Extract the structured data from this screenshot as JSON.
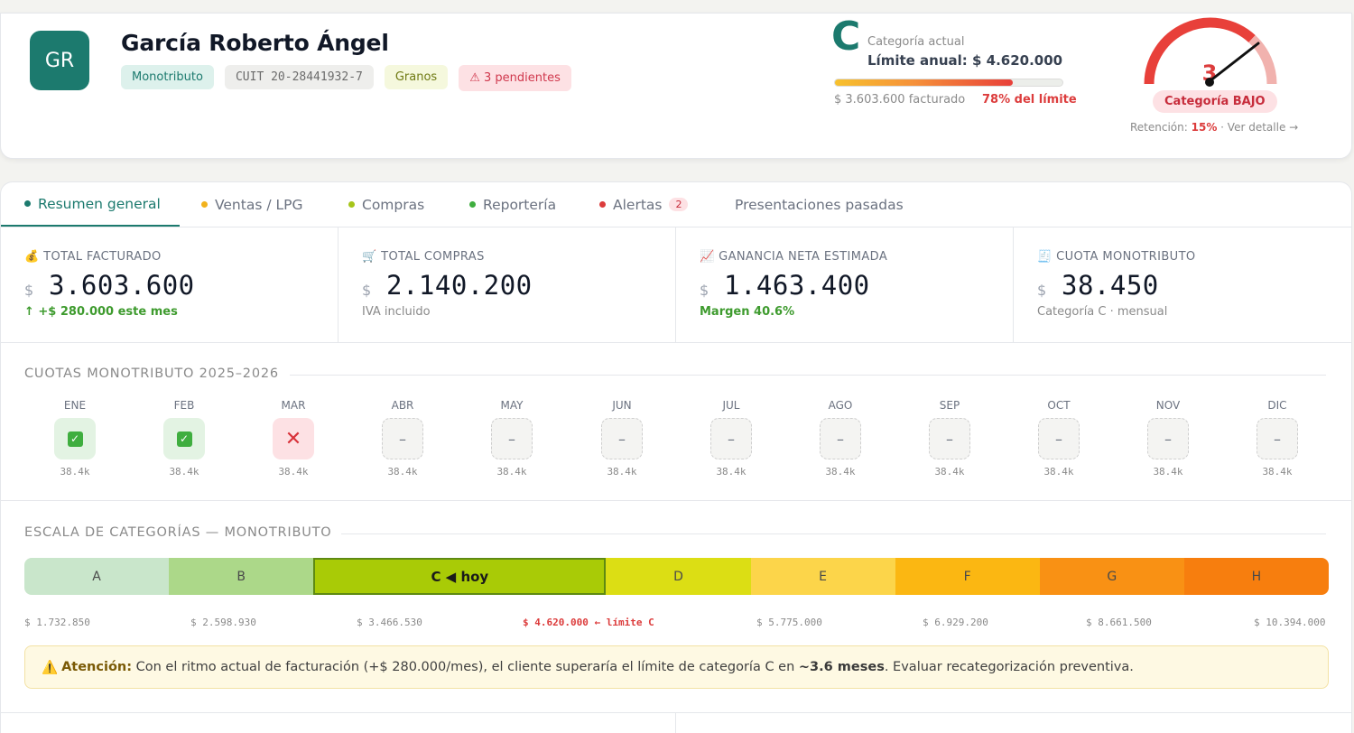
{
  "client": {
    "initials": "GR",
    "name": "García Roberto Ángel",
    "badges": {
      "regime": "Monotributo",
      "cuit": "CUIT 20-28441932-7",
      "activity": "Granos",
      "pending": "⚠ 3 pendientes"
    }
  },
  "category": {
    "letter": "C",
    "label": "Categoría actual",
    "limit_text": "Límite anual: $ 4.620.000",
    "billed_text": "$ 3.603.600 facturado",
    "pct_text": "78% del límite",
    "pct_value": 0.78
  },
  "risk": {
    "gauge_value": "3",
    "badge": "Categoría BAJO",
    "retention_prefix": "Retención: ",
    "retention_value": "15%",
    "retention_suffix": " · Ver detalle →",
    "colors": {
      "high": "#e8403a",
      "low": "#f1b2ae",
      "needle": "#111111"
    }
  },
  "tabs": [
    {
      "label": "Resumen general",
      "dot": "#1c7a6e",
      "active": true
    },
    {
      "label": "Ventas / LPG",
      "dot": "#f2b21c"
    },
    {
      "label": "Compras",
      "dot": "#a6c51a"
    },
    {
      "label": "Reportería",
      "dot": "#3fae3f"
    },
    {
      "label": "Alertas",
      "dot": "#dc3c3c",
      "count": "2"
    },
    {
      "label": "Presentaciones pasadas"
    }
  ],
  "stats": [
    {
      "icon": "money-bag-icon",
      "glyph": "💰",
      "label": "TOTAL FACTURADO",
      "currency": "$",
      "value": "3.603.600",
      "note": "↑ +$ 280.000 este mes",
      "note_green": true
    },
    {
      "icon": "cart-icon",
      "glyph": "🛒",
      "label": "TOTAL COMPRAS",
      "currency": "$",
      "value": "2.140.200",
      "note": "IVA incluido"
    },
    {
      "icon": "chart-up-icon",
      "glyph": "📈",
      "label": "GANANCIA NETA ESTIMADA",
      "currency": "$",
      "value": "1.463.400",
      "note": "Margen 40.6%",
      "note_green": true
    },
    {
      "icon": "receipt-icon",
      "glyph": "🧾",
      "label": "CUOTA MONOTRIBUTO",
      "currency": "$",
      "value": "38.450",
      "note": "Categoría C · mensual"
    }
  ],
  "quotas": {
    "title": "CUOTAS MONOTRIBUTO 2025–2026",
    "months": [
      {
        "name": "ENE",
        "status": "paid",
        "mark": "✓",
        "amount": "38.4k"
      },
      {
        "name": "FEB",
        "status": "paid",
        "mark": "✓",
        "amount": "38.4k"
      },
      {
        "name": "MAR",
        "status": "missed",
        "mark": "✕",
        "amount": "38.4k"
      },
      {
        "name": "ABR",
        "status": "pending",
        "mark": "–",
        "amount": "38.4k"
      },
      {
        "name": "MAY",
        "status": "pending",
        "mark": "–",
        "amount": "38.4k"
      },
      {
        "name": "JUN",
        "status": "pending",
        "mark": "–",
        "amount": "38.4k"
      },
      {
        "name": "JUL",
        "status": "pending",
        "mark": "–",
        "amount": "38.4k"
      },
      {
        "name": "AGO",
        "status": "pending",
        "mark": "–",
        "amount": "38.4k"
      },
      {
        "name": "SEP",
        "status": "pending",
        "mark": "–",
        "amount": "38.4k"
      },
      {
        "name": "OCT",
        "status": "pending",
        "mark": "–",
        "amount": "38.4k"
      },
      {
        "name": "NOV",
        "status": "pending",
        "mark": "–",
        "amount": "38.4k"
      },
      {
        "name": "DIC",
        "status": "pending",
        "mark": "–",
        "amount": "38.4k"
      }
    ]
  },
  "scale": {
    "title": "ESCALA DE CATEGORÍAS — MONOTRIBUTO",
    "segments": [
      {
        "label": "A",
        "color": "#c9e6cb"
      },
      {
        "label": "B",
        "color": "#acd889"
      },
      {
        "label": "C ◀ hoy",
        "color": "#a9cb06",
        "current": true
      },
      {
        "label": "D",
        "color": "#dcde14"
      },
      {
        "label": "E",
        "color": "#fcd54a"
      },
      {
        "label": "F",
        "color": "#fbb712"
      },
      {
        "label": "G",
        "color": "#f99114"
      },
      {
        "label": "H",
        "color": "#f77e0e"
      }
    ],
    "limits": [
      {
        "text": "$ 1.732.850"
      },
      {
        "text": "$ 2.598.930"
      },
      {
        "text": "$ 3.466.530"
      },
      {
        "text": "$ 4.620.000 ← límite C",
        "hot": true
      },
      {
        "text": "$ 5.775.000"
      },
      {
        "text": "$ 6.929.200"
      },
      {
        "text": "$ 8.661.500"
      },
      {
        "text": "$ 10.394.000"
      }
    ]
  },
  "alert": {
    "icon": "⚠️",
    "lead": "Atención:",
    "text_1": " Con el ritmo actual de facturación (+$ 280.000/mes), el cliente superaría el límite de categoría C en ",
    "strong": "~3.6 meses",
    "text_2": ". Evaluar recategorización preventiva."
  }
}
